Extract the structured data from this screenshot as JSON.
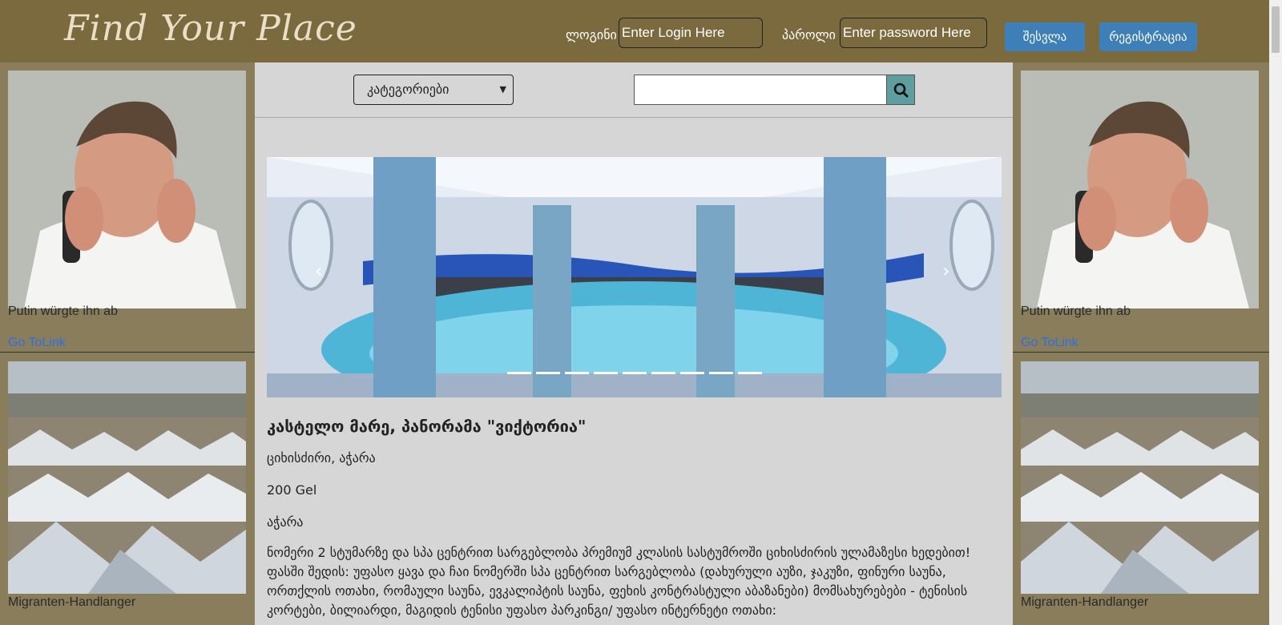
{
  "header": {
    "logo": "Find Your Place",
    "login_label": "ლოგინი",
    "login_placeholder": "Enter Login Here",
    "password_label": "პაროლი",
    "password_placeholder": "Enter password Here",
    "signin_button": "შესვლა",
    "register_button": "რეგისტრაცია"
  },
  "ads": {
    "left": [
      {
        "caption": "Putin würgte ihn ab",
        "link": "Go ToLink"
      },
      {
        "caption": "Migranten-Handlanger"
      }
    ],
    "right": [
      {
        "caption": "Putin würgte ihn ab",
        "link": "Go ToLink"
      },
      {
        "caption": "Migranten-Handlanger"
      }
    ]
  },
  "filters": {
    "category_select": "კატეგორიები",
    "search_value": ""
  },
  "listing": {
    "title": "კასტელო მარე, პანორამა \"ვიქტორია\"",
    "location": "ციხისძირი, აჭარა",
    "price": "200 Gel",
    "region": "აჭარა",
    "description": "ნომერი 2 სტუმარზე და სპა ცენტრით სარგებლობა პრემიუმ კლასის სასტუმროში ციხისძირის ულამაზესი ხედებით! ფასში შედის: უფასო ყავა და ჩაი ნომერში სპა ცენტრით სარგებლობა (დახურული აუზი, ჯაკუზი, ფინური საუნა, ორთქლის ოთახი, რომაული საუნა, ევკალიპტის საუნა, ფეხის კონტრასტული აბაზანები) მომსახურებები - ტენისის კორტები, ბილიარდი, მაგიდის ტენისი უფასო პარკინგი/ უფასო ინტერნეტი ოთახი:"
  },
  "carousel": {
    "slide_count": 9,
    "active_index": 2
  },
  "colors": {
    "header": "#7a6a3e",
    "button": "#3f7fb8",
    "search_button": "#5f9ea0",
    "link": "#2f6fe0"
  }
}
